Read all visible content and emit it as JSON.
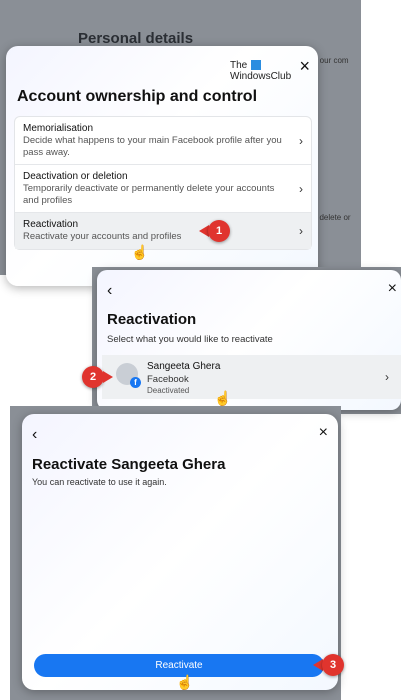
{
  "panel1": {
    "background_heading": "Personal details",
    "edge_text_1": "p our com",
    "edge_text_2": "s, delete or",
    "logo_line1": "The",
    "logo_line2": "WindowsClub",
    "close_icon": "×",
    "title": "Account ownership and control",
    "items": [
      {
        "title": "Memorialisation",
        "desc": "Decide what happens to your main Facebook profile after you pass away."
      },
      {
        "title": "Deactivation or deletion",
        "desc": "Temporarily deactivate or permanently delete your accounts and profiles"
      },
      {
        "title": "Reactivation",
        "desc": "Reactivate your accounts and profiles"
      }
    ],
    "chevron": "›"
  },
  "panel2": {
    "back_icon": "‹",
    "close_icon": "×",
    "title": "Reactivation",
    "subtitle": "Select what you would like to reactivate",
    "account": {
      "name": "Sangeeta Ghera",
      "platform": "Facebook",
      "status": "Deactivated",
      "badge": "f"
    },
    "chevron": "›"
  },
  "panel3": {
    "back_icon": "‹",
    "close_icon": "×",
    "title": "Reactivate Sangeeta Ghera",
    "subtitle": "You can reactivate to use it again.",
    "button_label": "Reactivate"
  },
  "callouts": [
    "1",
    "2",
    "3"
  ],
  "cursor_glyph": "☝",
  "colors": {
    "accent": "#1877f2",
    "callout": "#e0342e"
  }
}
